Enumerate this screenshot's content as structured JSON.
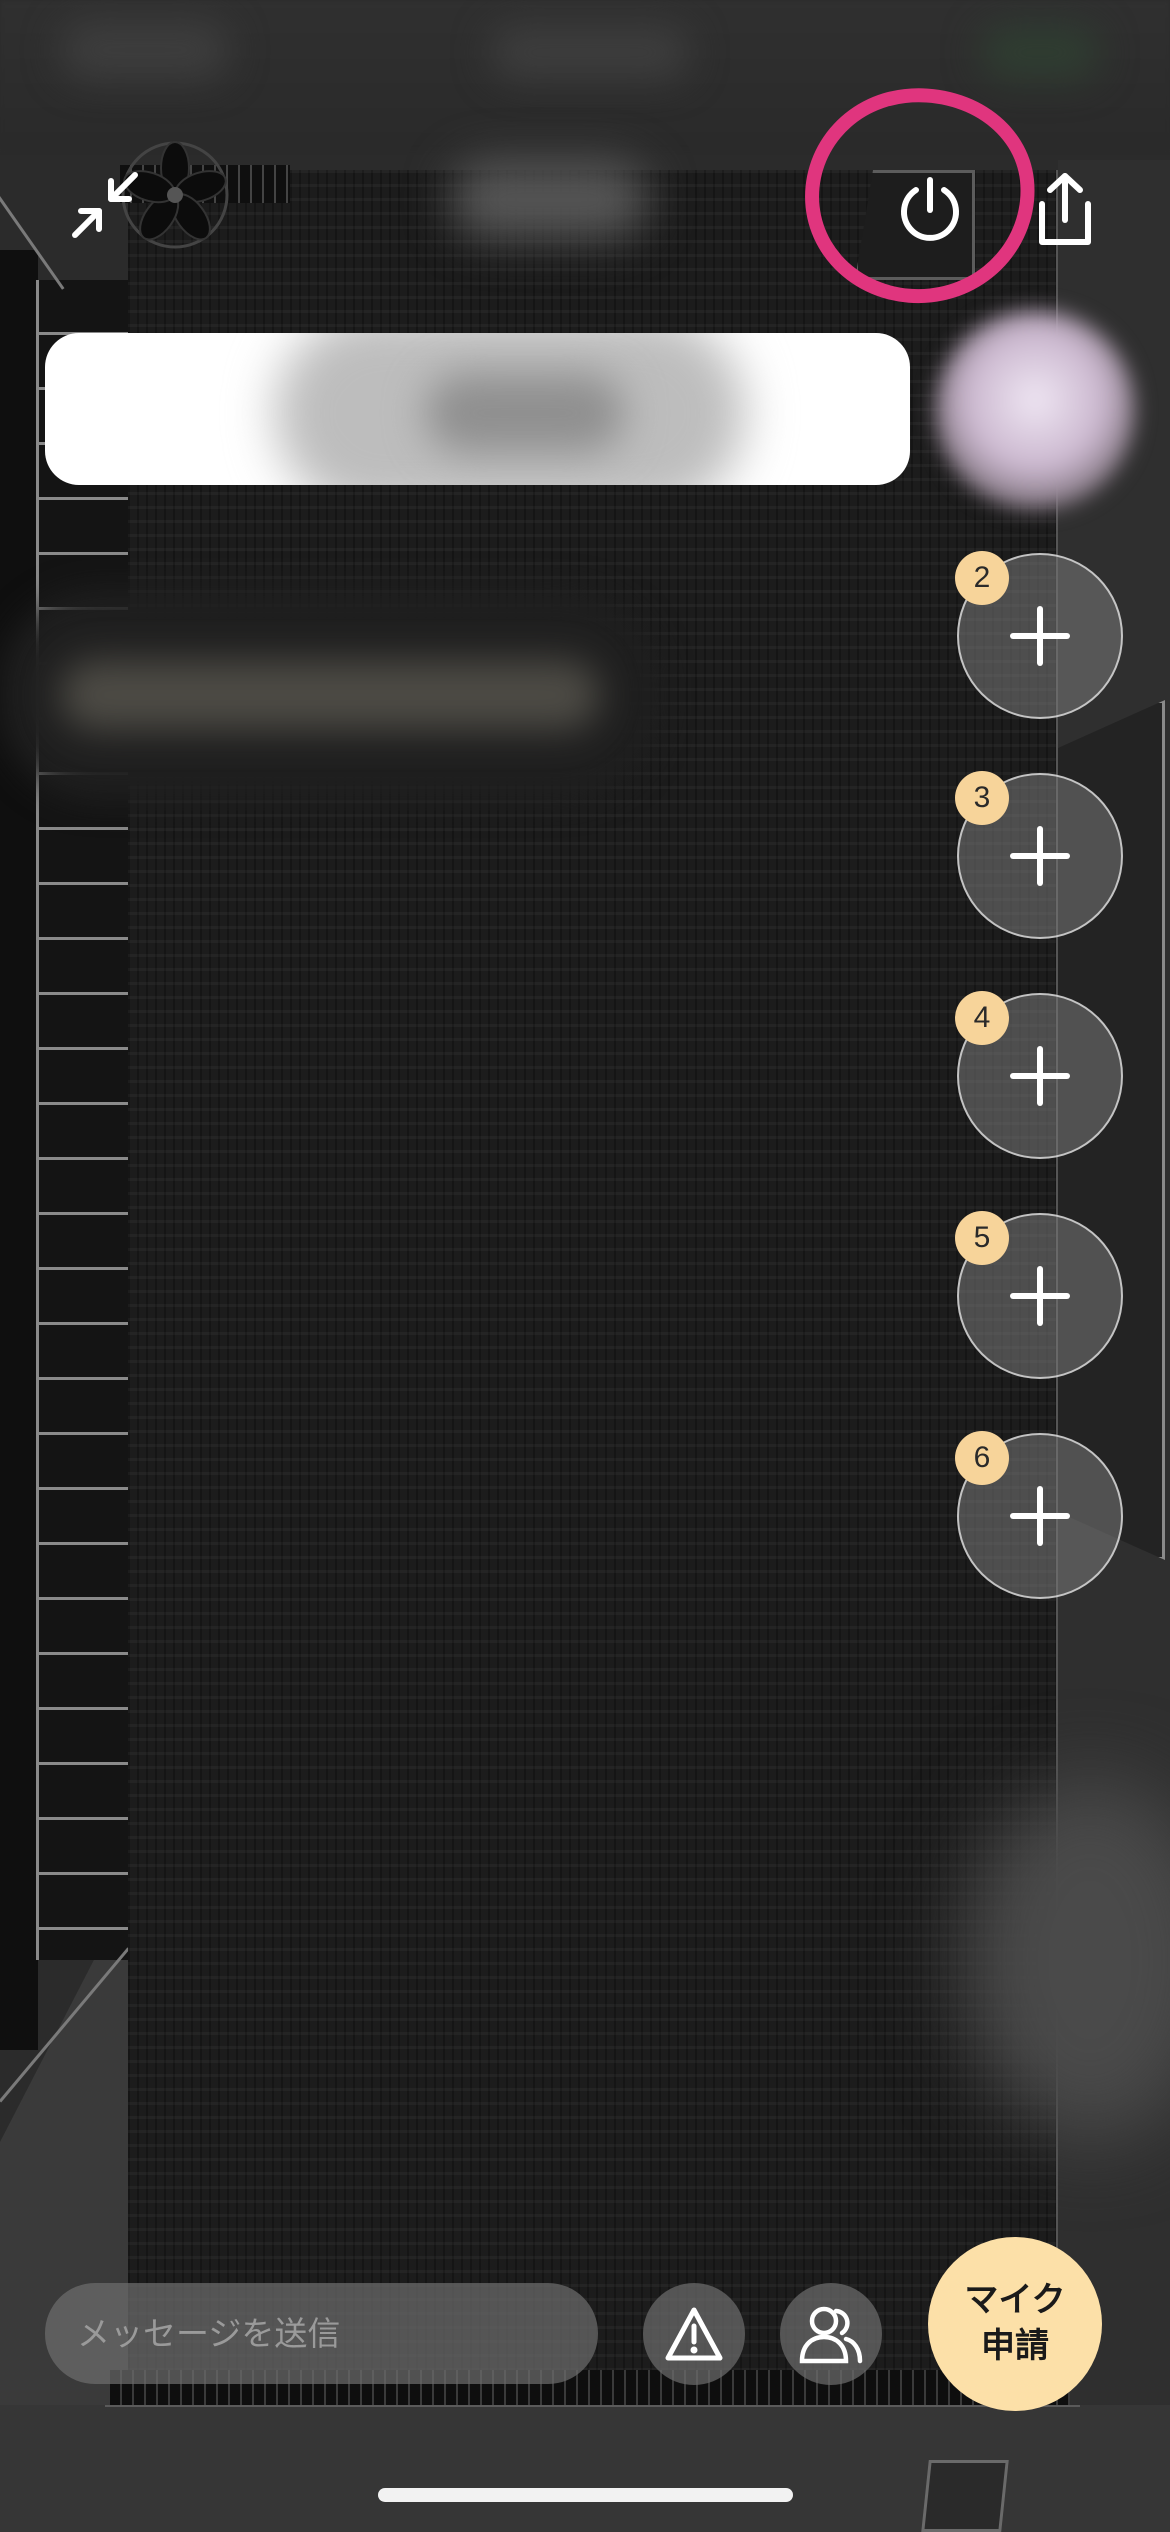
{
  "header": {
    "minimize_icon": "minimize-arrows-icon",
    "logo_icon": "flower-logo-icon",
    "power_icon": "power-icon",
    "share_icon": "share-upload-icon",
    "highlight_color": "#e0357e"
  },
  "seats": [
    {
      "number": "2"
    },
    {
      "number": "3"
    },
    {
      "number": "4"
    },
    {
      "number": "5"
    },
    {
      "number": "6"
    }
  ],
  "bottom_bar": {
    "message_placeholder": "メッセージを送信",
    "report_icon": "warning-triangle-icon",
    "members_icon": "people-icon",
    "mic_request_line1": "マイク",
    "mic_request_line2": "申請",
    "mic_button_color": "#fce0a8"
  }
}
